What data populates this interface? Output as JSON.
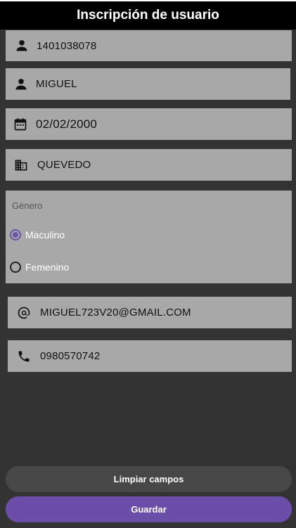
{
  "header": {
    "title": "Inscripción de usuario"
  },
  "fields": {
    "cedula": {
      "value": "1401038078",
      "icon": "person-icon"
    },
    "nombre": {
      "value": "MIGUEL",
      "icon": "person-icon"
    },
    "fecha": {
      "value": "02/02/2000",
      "icon": "calendar-icon"
    },
    "ciudad": {
      "value": "QUEVEDO",
      "icon": "building-icon"
    },
    "email": {
      "value": "MIGUEL723V20@GMAIL.COM",
      "icon": "at-icon"
    },
    "telefono": {
      "value": "0980570742",
      "icon": "phone-icon"
    }
  },
  "gender": {
    "label": "Género",
    "options": [
      "Maculino",
      "Femenino"
    ],
    "selected": "Maculino"
  },
  "buttons": {
    "clear_label": "Limpiar campos",
    "save_label": "Guardar"
  },
  "colors": {
    "accent": "#6a4ea8",
    "field_bg": "#a8a8a8",
    "page_bg": "#333333"
  }
}
